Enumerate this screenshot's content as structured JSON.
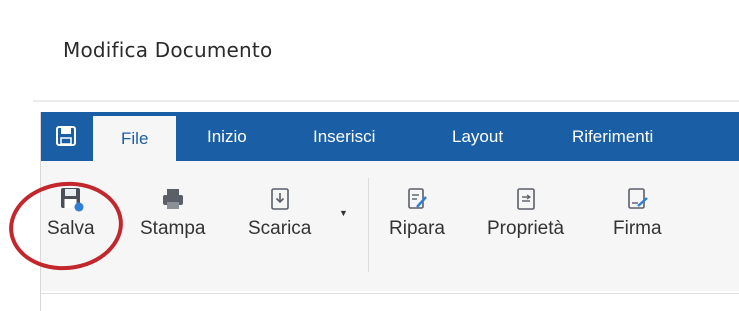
{
  "header": {
    "title": "Modifica Documento"
  },
  "tabs": [
    {
      "label": "File",
      "active": true
    },
    {
      "label": "Inizio",
      "active": false
    },
    {
      "label": "Inserisci",
      "active": false
    },
    {
      "label": "Layout",
      "active": false
    },
    {
      "label": "Riferimenti",
      "active": false
    }
  ],
  "toolbar": {
    "save_label": "Salva",
    "print_label": "Stampa",
    "download_label": "Scarica",
    "repair_label": "Ripara",
    "properties_label": "Proprietà",
    "sign_label": "Firma"
  },
  "colors": {
    "tabbar": "#1a5fa6",
    "highlight": "#c1272d",
    "toolbar_bg": "#f6f6f6"
  },
  "icons": {
    "quick_access": "save-icon",
    "save": "save-icon",
    "print": "printer-icon",
    "download": "download-icon",
    "repair": "edit-document-icon",
    "properties": "properties-icon",
    "sign": "sign-icon"
  }
}
